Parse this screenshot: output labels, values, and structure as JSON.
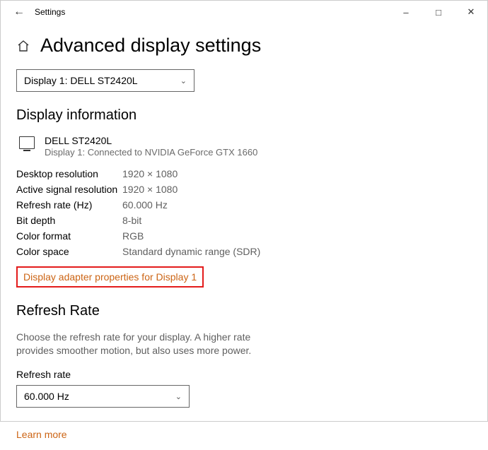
{
  "window": {
    "title": "Settings"
  },
  "page": {
    "heading": "Advanced display settings",
    "displaySelector": "Display 1: DELL ST2420L"
  },
  "info": {
    "section": "Display information",
    "monitorName": "DELL ST2420L",
    "monitorSub": "Display 1: Connected to NVIDIA GeForce GTX 1660",
    "rows": {
      "desktopRes": {
        "k": "Desktop resolution",
        "v": "1920 × 1080"
      },
      "activeRes": {
        "k": "Active signal resolution",
        "v": "1920 × 1080"
      },
      "refreshHz": {
        "k": "Refresh rate (Hz)",
        "v": "60.000 Hz"
      },
      "bitDepth": {
        "k": "Bit depth",
        "v": "8-bit"
      },
      "colorFormat": {
        "k": "Color format",
        "v": "RGB"
      },
      "colorSpace": {
        "k": "Color space",
        "v": "Standard dynamic range (SDR)"
      }
    },
    "adapterLink": "Display adapter properties for Display 1"
  },
  "refresh": {
    "section": "Refresh Rate",
    "desc": "Choose the refresh rate for your display. A higher rate provides smoother motion, but also uses more power.",
    "label": "Refresh rate",
    "value": "60.000 Hz",
    "learnMore": "Learn more"
  }
}
